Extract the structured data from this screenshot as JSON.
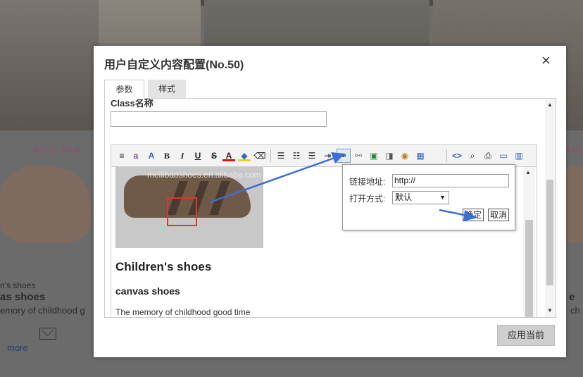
{
  "background": {
    "brand_left": "MEILIBA",
    "brand_right": "ME",
    "caption_small": "n's shoes",
    "caption_big": "as shoes",
    "caption_line": "emory of childhood g",
    "more_link": "more",
    "caption_right_big": "e",
    "caption_right_line": "ch"
  },
  "dialog": {
    "title": "用户自定义内容配置(No.50)",
    "close_glyph": "×",
    "tabs": [
      "参数",
      "样式"
    ],
    "class_label": "Class名称",
    "class_value": "",
    "apply_button": "应用当前"
  },
  "toolbar": {
    "icons": [
      "line-height",
      "spellcheck",
      "font-family",
      "bold",
      "italic",
      "underline",
      "strikethrough",
      "font-color",
      "background-color",
      "eraser",
      "align-left",
      "ordered-list",
      "unordered-list",
      "indent",
      "link",
      "unlink",
      "image",
      "flash",
      "media",
      "table",
      "source",
      "preview",
      "print",
      "select-all",
      "fullscreen"
    ]
  },
  "content": {
    "watermark": "meilibaoshoes.en.alibaba.com",
    "heading_big": "Children's shoes",
    "heading_mid": "canvas shoes",
    "paragraph": "The memory of childhood good time"
  },
  "link_popup": {
    "url_label": "链接地址:",
    "url_value": "http://",
    "open_label": "打开方式:",
    "open_value": "默认",
    "ok_button": "确定",
    "cancel_button": "取消"
  },
  "annotation_color": "#3a6fd6",
  "highlight_color": "#e53232"
}
